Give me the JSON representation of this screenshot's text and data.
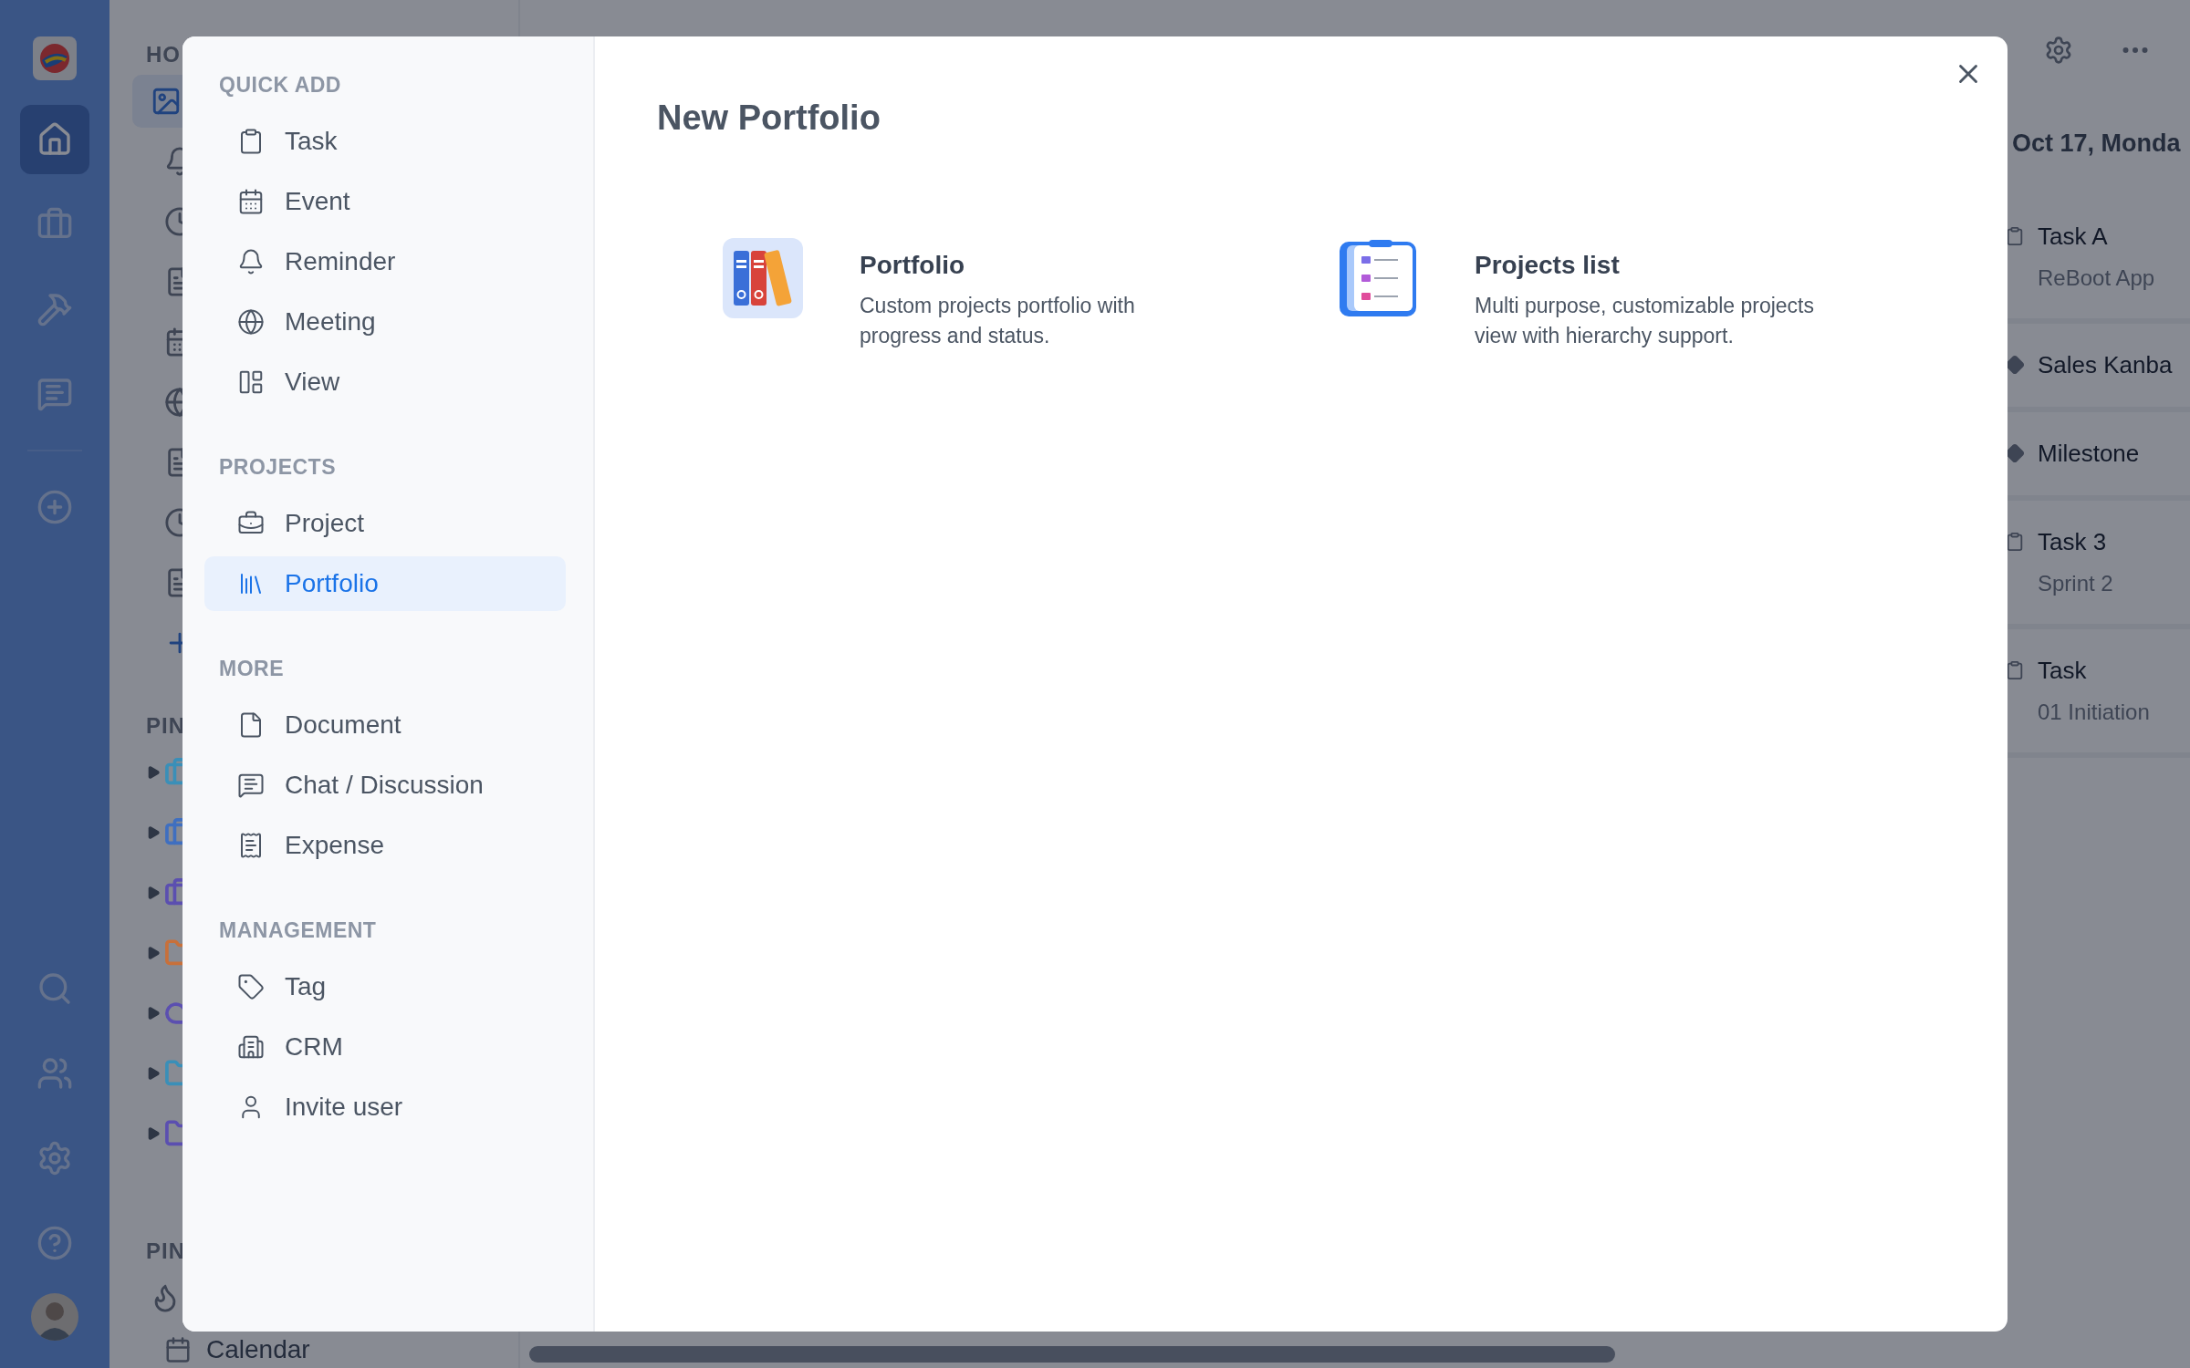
{
  "rail": {
    "items": [
      {
        "selected": true
      },
      {
        "selected": false
      },
      {
        "selected": false
      },
      {
        "selected": false
      }
    ]
  },
  "background_sidebar": {
    "heading": "HO",
    "pinned_heading": "PIN",
    "pinned": [
      {
        "color": "#3a8fb8"
      },
      {
        "color": "#3f6fc0"
      },
      {
        "color": "#5b4fb0"
      },
      {
        "color": "#c8703a"
      },
      {
        "color": "#5b4fb0"
      },
      {
        "color": "#3a8fb8"
      },
      {
        "color": "#5b4fb0"
      }
    ],
    "second_pinned_heading": "PIN",
    "calendar_item": "Calendar"
  },
  "agenda": {
    "date": "Oct 17, Monda",
    "events": [
      {
        "kind": "task",
        "title": "Task A",
        "subtitle": "ReBoot App"
      },
      {
        "kind": "milestone",
        "title": "Sales Kanba"
      },
      {
        "kind": "milestone",
        "title": "Milestone"
      },
      {
        "kind": "task",
        "title": "Task 3",
        "subtitle": "Sprint 2"
      },
      {
        "kind": "task",
        "title": "Task",
        "subtitle": "01 Initiation"
      }
    ]
  },
  "dialog": {
    "title": "New Portfolio",
    "menu": [
      {
        "heading": "QUICK ADD",
        "items": [
          {
            "label": "Task",
            "selected": false
          },
          {
            "label": "Event",
            "selected": false
          },
          {
            "label": "Reminder",
            "selected": false
          },
          {
            "label": "Meeting",
            "selected": false
          },
          {
            "label": "View",
            "selected": false
          }
        ]
      },
      {
        "heading": "PROJECTS",
        "items": [
          {
            "label": "Project",
            "selected": false
          },
          {
            "label": "Portfolio",
            "selected": true
          }
        ]
      },
      {
        "heading": "MORE",
        "items": [
          {
            "label": "Document",
            "selected": false
          },
          {
            "label": "Chat / Discussion",
            "selected": false
          },
          {
            "label": "Expense",
            "selected": false
          }
        ]
      },
      {
        "heading": "MANAGEMENT",
        "items": [
          {
            "label": "Tag",
            "selected": false
          },
          {
            "label": "CRM",
            "selected": false
          },
          {
            "label": "Invite user",
            "selected": false
          }
        ]
      }
    ],
    "options": [
      {
        "kind": "portfolio",
        "title": "Portfolio",
        "description": "Custom projects portfolio with progress and status."
      },
      {
        "kind": "list",
        "title": "Projects list",
        "description": "Multi purpose, customizable projects view with hierarchy support."
      }
    ]
  }
}
